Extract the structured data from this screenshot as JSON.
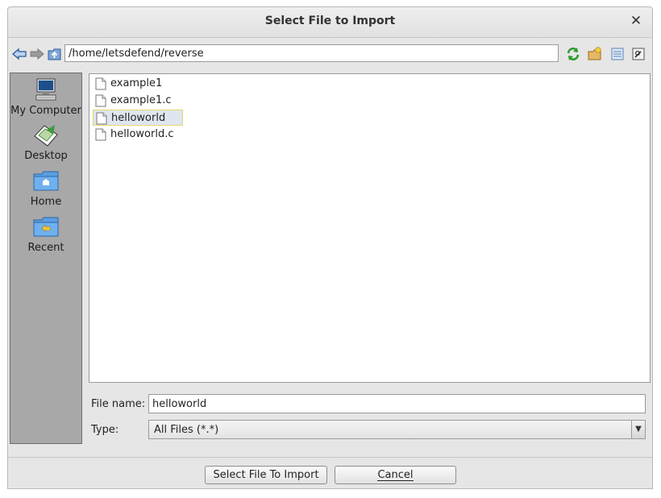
{
  "window": {
    "title": "Select File to Import",
    "close": "✕"
  },
  "toolbar": {
    "path": "/home/letsdefend/reverse"
  },
  "sidebar": {
    "items": [
      {
        "label": "My Computer",
        "icon": "computer-icon"
      },
      {
        "label": "Desktop",
        "icon": "desktop-icon"
      },
      {
        "label": "Home",
        "icon": "home-folder-icon"
      },
      {
        "label": "Recent",
        "icon": "recent-folder-icon"
      }
    ]
  },
  "files": [
    {
      "name": "example1",
      "selected": false
    },
    {
      "name": "example1.c",
      "selected": false
    },
    {
      "name": "helloworld",
      "selected": true
    },
    {
      "name": "helloworld.c",
      "selected": false
    }
  ],
  "form": {
    "file_name_label": "File name:",
    "file_name_value": "helloworld",
    "type_label": "Type:",
    "type_value": "All Files (*.*)"
  },
  "buttons": {
    "import_label": "Select File To Import",
    "cancel_label": "Cancel"
  },
  "colors": {
    "sidebar_bg": "#a8a8a8",
    "selection_bg": "#dfe6ef",
    "selection_border": "#e8d76a",
    "dialog_bg": "#e6e6e6"
  }
}
